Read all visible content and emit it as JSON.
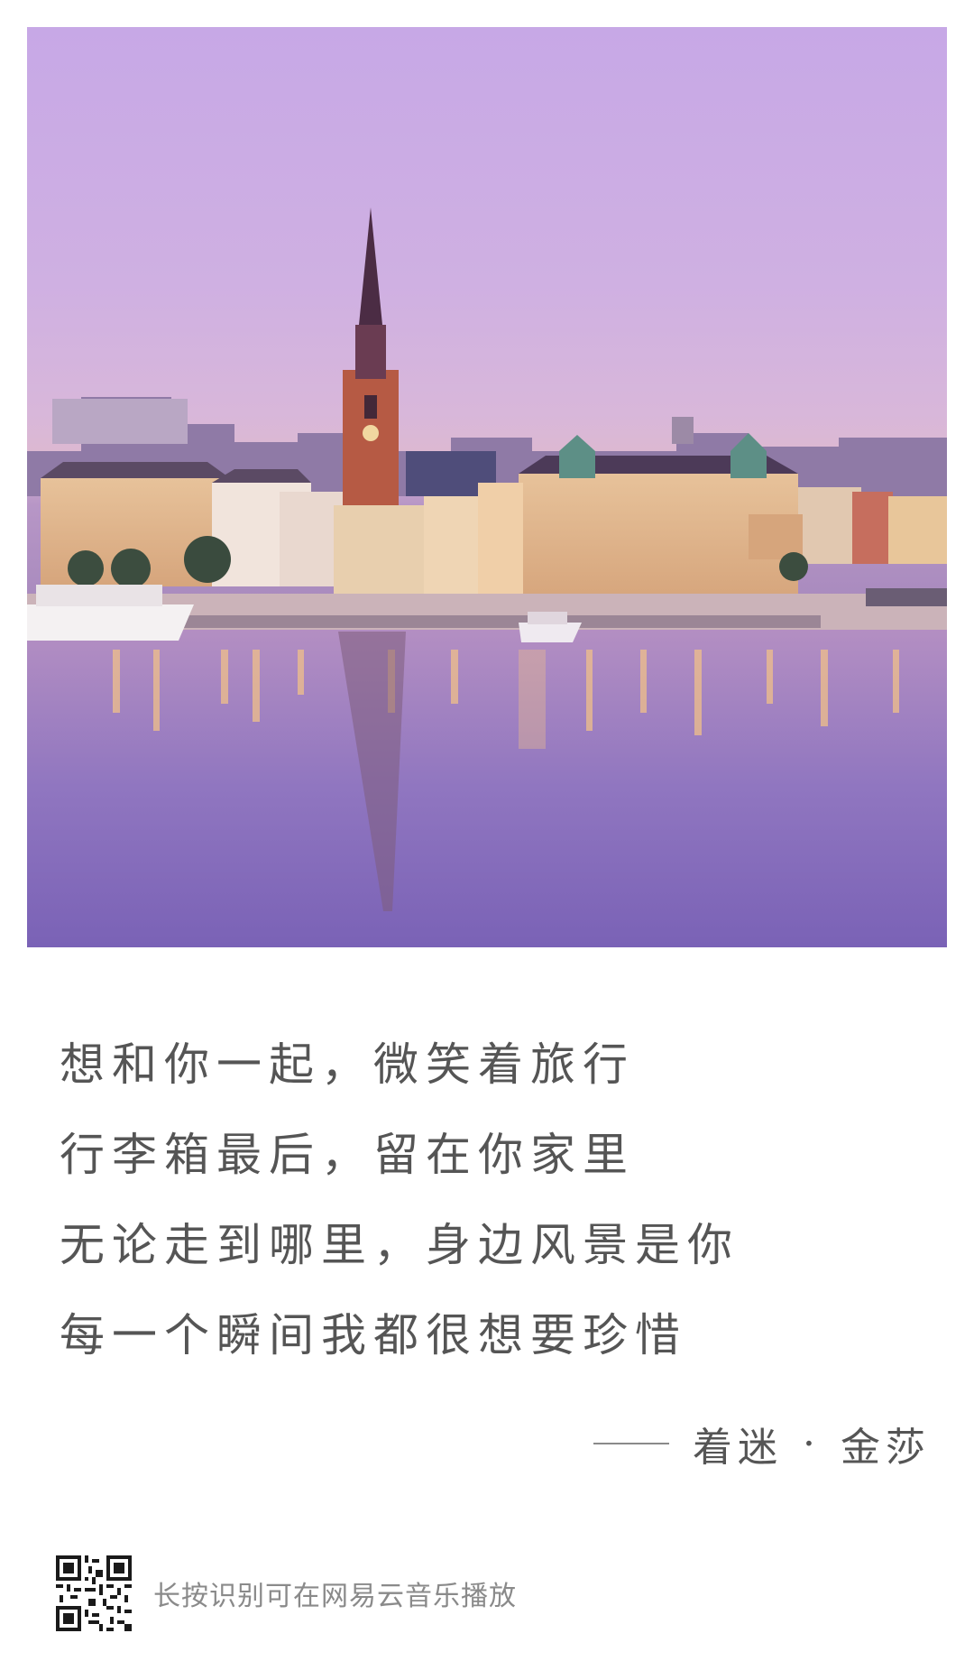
{
  "lyrics": {
    "lines": [
      "想和你一起，微笑着旅行",
      "行李箱最后，留在你家里",
      "无论走到哪里，身边风景是你",
      "每一个瞬间我都很想要珍惜"
    ]
  },
  "attribution": {
    "song": "着迷",
    "separator": "·",
    "artist": "金莎"
  },
  "footer": {
    "qr_icon": "qr-code-icon",
    "text": "长按识别可在网易云音乐播放"
  },
  "colors": {
    "lyric_text": "#555555",
    "footer_text": "#8a8a8a",
    "sky_top": "#c7a8e6",
    "water": "#8f74c0"
  }
}
